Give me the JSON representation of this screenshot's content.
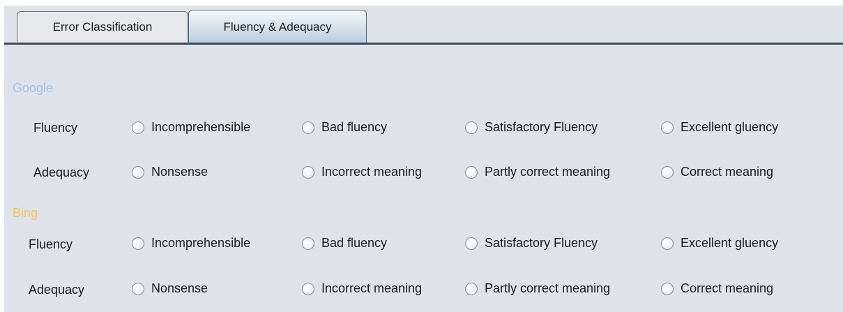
{
  "tabs": [
    {
      "label": "Error Classification",
      "active": false
    },
    {
      "label": "Fluency & Adequacy",
      "active": true
    }
  ],
  "sections": [
    {
      "name": "Google",
      "color": "#9ec3ea",
      "rows": [
        {
          "label": "Fluency",
          "options": [
            "Incomprehensible",
            "Bad fluency",
            "Satisfactory Fluency",
            "Excellent gluency"
          ]
        },
        {
          "label": "Adequacy",
          "options": [
            "Nonsense",
            "Incorrect meaning",
            "Partly correct meaning",
            "Correct meaning"
          ]
        }
      ]
    },
    {
      "name": "Bing",
      "color": "#f2c55a",
      "rows": [
        {
          "label": "Fluency",
          "options": [
            "Incomprehensible",
            "Bad fluency",
            "Satisfactory Fluency",
            "Excellent gluency"
          ]
        },
        {
          "label": "Adequacy",
          "options": [
            "Nonsense",
            "Incorrect meaning",
            "Partly correct meaning",
            "Correct meaning"
          ]
        }
      ]
    }
  ]
}
